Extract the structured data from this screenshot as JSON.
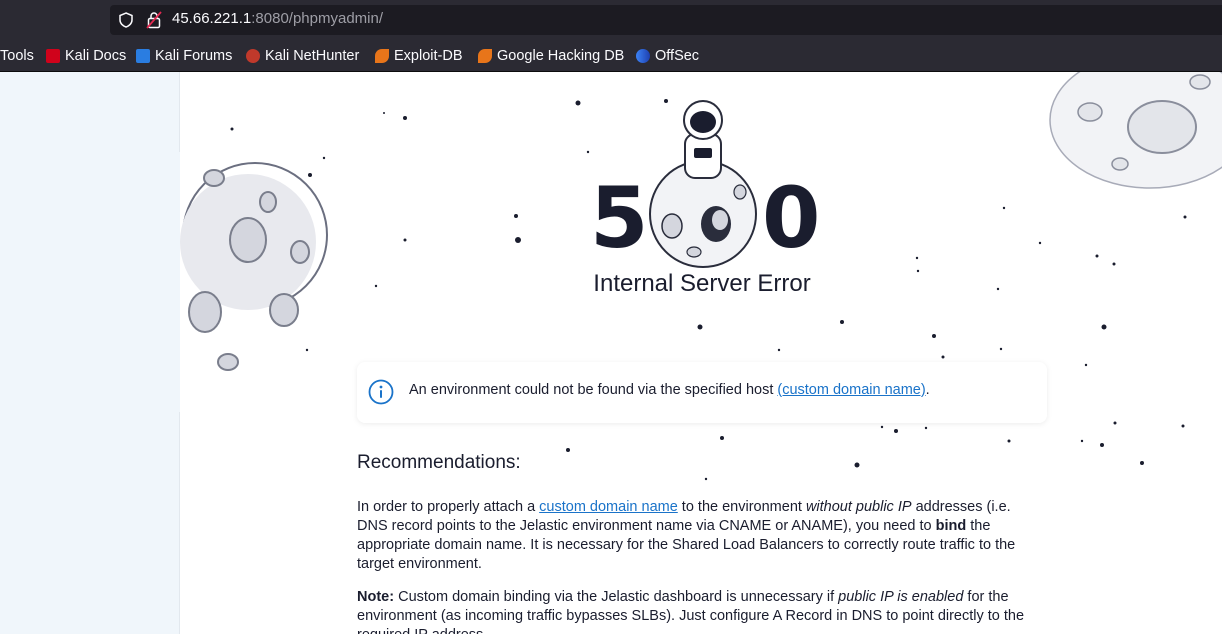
{
  "browser": {
    "url_host": "45.66.221.1",
    "url_rest": ":8080/phpmyadmin/",
    "bookmarks": [
      {
        "label": "Tools",
        "icon": "none"
      },
      {
        "label": "Kali Docs",
        "icon": "kali-docs-icon"
      },
      {
        "label": "Kali Forums",
        "icon": "kali-forums-icon"
      },
      {
        "label": "Kali NetHunter",
        "icon": "kali-nethunter-icon"
      },
      {
        "label": "Exploit-DB",
        "icon": "exploit-db-icon"
      },
      {
        "label": "Google Hacking DB",
        "icon": "ghdb-icon"
      },
      {
        "label": "OffSec",
        "icon": "offsec-icon"
      }
    ]
  },
  "page": {
    "code_left": "5",
    "code_right": "0",
    "error_title": "Internal Server Error",
    "info": {
      "text": "An environment could not be found via the specified host ",
      "link": "(custom domain name)",
      "tail": "."
    },
    "recommendations_title": "Recommendations:",
    "p1": {
      "a": "In order to properly attach a ",
      "link": "custom domain name",
      "b": " to the environment ",
      "em": "without public IP",
      "c": " addresses (i.e. DNS record points to the Jelastic environment name via CNAME or ANAME), you need to ",
      "strong": "bind",
      "d": " the appropriate domain name. It is necessary for the Shared Load Balancers to correctly route traffic to the target environment."
    },
    "p2": {
      "strong": "Note:",
      "a": " Custom domain binding via the Jelastic dashboard is unnecessary if ",
      "em": "public IP is enabled",
      "b": " for the environment (as incoming traffic bypasses SLBs). Just configure A Record in DNS to point directly to the required IP address."
    }
  },
  "colors": {
    "chrome_bg": "#2b2a33",
    "urlbar_bg": "#1c1b22",
    "link": "#1a73c9",
    "text": "#1a1d2e",
    "sidepanel": "#f0f6fb"
  }
}
